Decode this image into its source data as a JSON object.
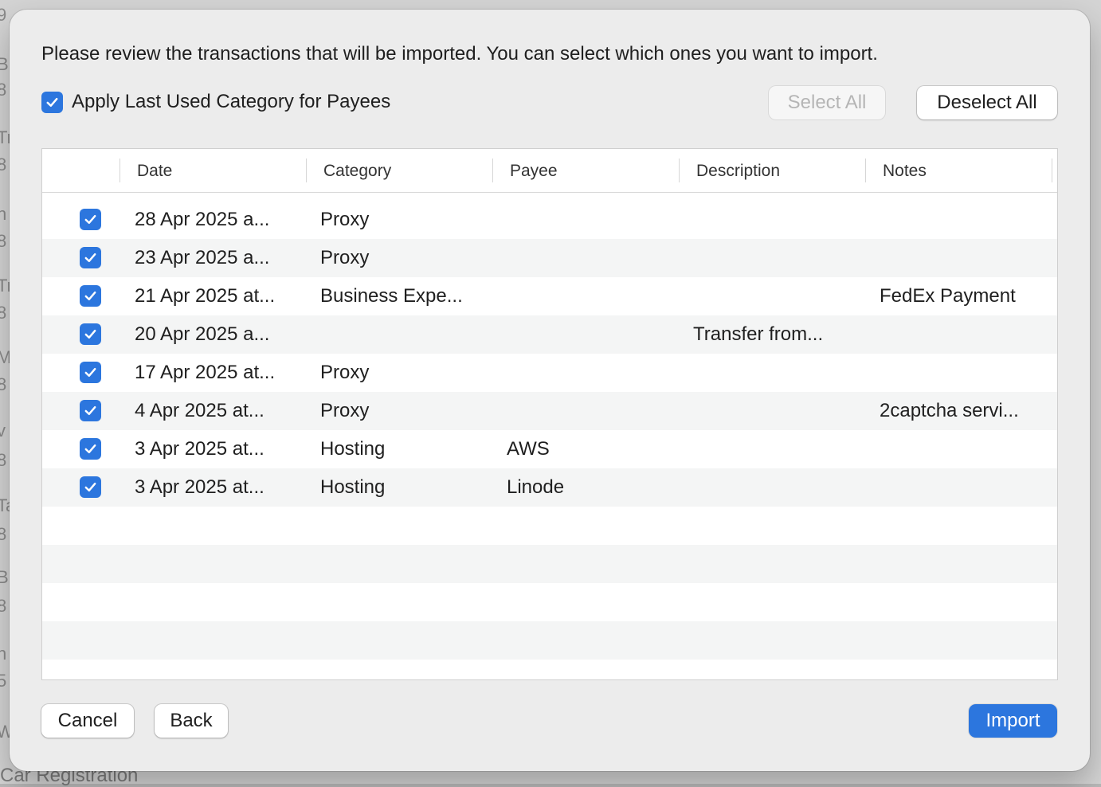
{
  "background": {
    "side_letters": [
      "9",
      "Bu",
      "8",
      "Tr",
      "8",
      "n",
      "8",
      "Tr",
      "8",
      "M",
      "8",
      "v",
      "8",
      "Ta",
      "8",
      "Bu",
      "8",
      "n",
      "5",
      "W"
    ],
    "bottom_text": "Car Registration"
  },
  "dialog": {
    "intro": "Please review the transactions that will be imported. You can select which ones you want to import.",
    "apply_label": "Apply Last Used Category for Payees",
    "apply_checked": true,
    "select_all": "Select All",
    "deselect_all": "Deselect All",
    "cancel": "Cancel",
    "back": "Back",
    "import": "Import"
  },
  "table": {
    "columns": [
      "Date",
      "Category",
      "Payee",
      "Description",
      "Notes"
    ],
    "rows": [
      {
        "checked": true,
        "date": "28 Apr 2025 a...",
        "category": "Proxy",
        "payee": "",
        "description": "",
        "notes": ""
      },
      {
        "checked": true,
        "date": "23 Apr 2025 a...",
        "category": "Proxy",
        "payee": "",
        "description": "",
        "notes": ""
      },
      {
        "checked": true,
        "date": "21 Apr 2025 at...",
        "category": "Business Expe...",
        "payee": "",
        "description": "",
        "notes": "FedEx Payment"
      },
      {
        "checked": true,
        "date": "20 Apr 2025 a...",
        "category": "",
        "payee": "",
        "description": "Transfer from...",
        "notes": ""
      },
      {
        "checked": true,
        "date": "17 Apr 2025 at...",
        "category": "Proxy",
        "payee": "",
        "description": "",
        "notes": ""
      },
      {
        "checked": true,
        "date": "4 Apr 2025 at...",
        "category": "Proxy",
        "payee": "",
        "description": "",
        "notes": "2captcha servi..."
      },
      {
        "checked": true,
        "date": "3 Apr 2025 at...",
        "category": "Hosting",
        "payee": "AWS",
        "description": "",
        "notes": ""
      },
      {
        "checked": true,
        "date": "3 Apr 2025 at...",
        "category": "Hosting",
        "payee": "Linode",
        "description": "",
        "notes": ""
      }
    ],
    "empty_rows": 5
  },
  "colors": {
    "accent": "#2c76de",
    "dialog_bg": "#ececec",
    "row_alt": "#f4f5f5"
  }
}
